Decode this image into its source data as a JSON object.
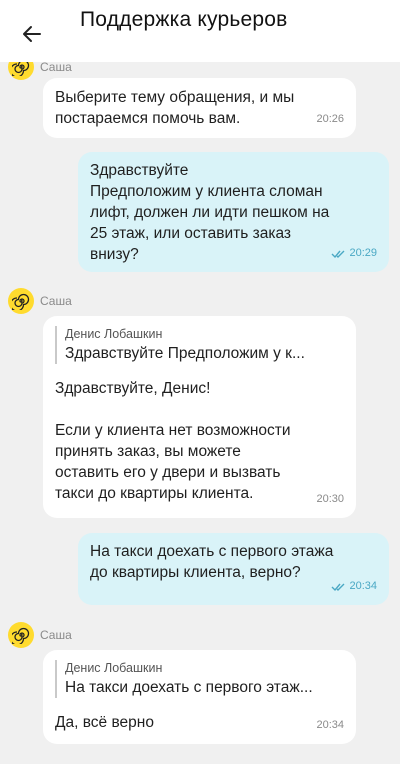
{
  "header": {
    "title": "Поддержка курьеров",
    "back_icon": "arrow-left-icon"
  },
  "messages": [
    {
      "sender": "Саша",
      "text": "Выберите тему обращения, и мы\nпостараемся помочь вам.",
      "time": "20:26"
    },
    {
      "text": "Здравствуйте\nПредположим у клиента сломан\nлифт, должен ли идти пешком на\n25 этаж, или оставить заказ\nвнизу?",
      "time": "20:29",
      "status": "read"
    },
    {
      "sender": "Саша",
      "quote_name": "Денис Лобашкин",
      "quote_text": "Здравствуйте Предположим у к...",
      "text": "Здравствуйте, Денис!\n\nЕсли у клиента нет возможности\nпринять заказ, вы можете\nоставить его у двери и вызвать\nтакси до квартиры клиента.",
      "time": "20:30"
    },
    {
      "text": "На такси доехать с первого этажа\nдо квартиры клиента, верно?",
      "time": "20:34",
      "status": "read"
    },
    {
      "sender": "Саша",
      "quote_name": "Денис Лобашкин",
      "quote_text": "На такси доехать с первого этаж...",
      "text": "Да, всё верно",
      "time": "20:34"
    }
  ],
  "colors": {
    "incoming_bubble": "#ffffff",
    "outgoing_bubble": "#d9f3f8",
    "avatar": "#ffdb2e",
    "read_check": "#4aa8c4"
  }
}
